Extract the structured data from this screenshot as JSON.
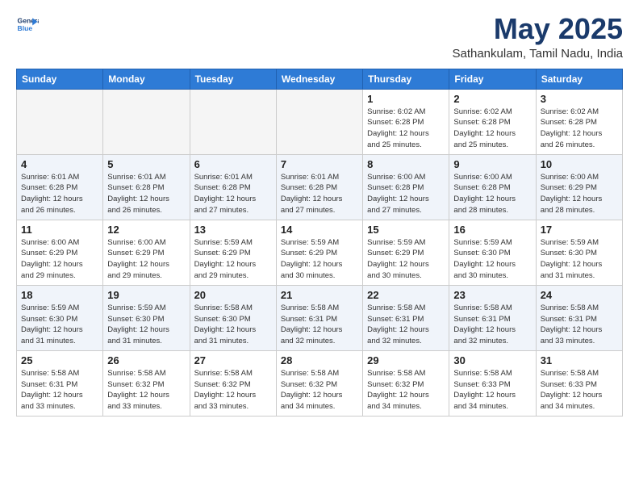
{
  "header": {
    "logo_line1": "General",
    "logo_line2": "Blue",
    "month": "May 2025",
    "location": "Sathankulam, Tamil Nadu, India"
  },
  "weekdays": [
    "Sunday",
    "Monday",
    "Tuesday",
    "Wednesday",
    "Thursday",
    "Friday",
    "Saturday"
  ],
  "weeks": [
    [
      {
        "day": "",
        "info": ""
      },
      {
        "day": "",
        "info": ""
      },
      {
        "day": "",
        "info": ""
      },
      {
        "day": "",
        "info": ""
      },
      {
        "day": "1",
        "info": "Sunrise: 6:02 AM\nSunset: 6:28 PM\nDaylight: 12 hours\nand 25 minutes."
      },
      {
        "day": "2",
        "info": "Sunrise: 6:02 AM\nSunset: 6:28 PM\nDaylight: 12 hours\nand 25 minutes."
      },
      {
        "day": "3",
        "info": "Sunrise: 6:02 AM\nSunset: 6:28 PM\nDaylight: 12 hours\nand 26 minutes."
      }
    ],
    [
      {
        "day": "4",
        "info": "Sunrise: 6:01 AM\nSunset: 6:28 PM\nDaylight: 12 hours\nand 26 minutes."
      },
      {
        "day": "5",
        "info": "Sunrise: 6:01 AM\nSunset: 6:28 PM\nDaylight: 12 hours\nand 26 minutes."
      },
      {
        "day": "6",
        "info": "Sunrise: 6:01 AM\nSunset: 6:28 PM\nDaylight: 12 hours\nand 27 minutes."
      },
      {
        "day": "7",
        "info": "Sunrise: 6:01 AM\nSunset: 6:28 PM\nDaylight: 12 hours\nand 27 minutes."
      },
      {
        "day": "8",
        "info": "Sunrise: 6:00 AM\nSunset: 6:28 PM\nDaylight: 12 hours\nand 27 minutes."
      },
      {
        "day": "9",
        "info": "Sunrise: 6:00 AM\nSunset: 6:28 PM\nDaylight: 12 hours\nand 28 minutes."
      },
      {
        "day": "10",
        "info": "Sunrise: 6:00 AM\nSunset: 6:29 PM\nDaylight: 12 hours\nand 28 minutes."
      }
    ],
    [
      {
        "day": "11",
        "info": "Sunrise: 6:00 AM\nSunset: 6:29 PM\nDaylight: 12 hours\nand 29 minutes."
      },
      {
        "day": "12",
        "info": "Sunrise: 6:00 AM\nSunset: 6:29 PM\nDaylight: 12 hours\nand 29 minutes."
      },
      {
        "day": "13",
        "info": "Sunrise: 5:59 AM\nSunset: 6:29 PM\nDaylight: 12 hours\nand 29 minutes."
      },
      {
        "day": "14",
        "info": "Sunrise: 5:59 AM\nSunset: 6:29 PM\nDaylight: 12 hours\nand 30 minutes."
      },
      {
        "day": "15",
        "info": "Sunrise: 5:59 AM\nSunset: 6:29 PM\nDaylight: 12 hours\nand 30 minutes."
      },
      {
        "day": "16",
        "info": "Sunrise: 5:59 AM\nSunset: 6:30 PM\nDaylight: 12 hours\nand 30 minutes."
      },
      {
        "day": "17",
        "info": "Sunrise: 5:59 AM\nSunset: 6:30 PM\nDaylight: 12 hours\nand 31 minutes."
      }
    ],
    [
      {
        "day": "18",
        "info": "Sunrise: 5:59 AM\nSunset: 6:30 PM\nDaylight: 12 hours\nand 31 minutes."
      },
      {
        "day": "19",
        "info": "Sunrise: 5:59 AM\nSunset: 6:30 PM\nDaylight: 12 hours\nand 31 minutes."
      },
      {
        "day": "20",
        "info": "Sunrise: 5:58 AM\nSunset: 6:30 PM\nDaylight: 12 hours\nand 31 minutes."
      },
      {
        "day": "21",
        "info": "Sunrise: 5:58 AM\nSunset: 6:31 PM\nDaylight: 12 hours\nand 32 minutes."
      },
      {
        "day": "22",
        "info": "Sunrise: 5:58 AM\nSunset: 6:31 PM\nDaylight: 12 hours\nand 32 minutes."
      },
      {
        "day": "23",
        "info": "Sunrise: 5:58 AM\nSunset: 6:31 PM\nDaylight: 12 hours\nand 32 minutes."
      },
      {
        "day": "24",
        "info": "Sunrise: 5:58 AM\nSunset: 6:31 PM\nDaylight: 12 hours\nand 33 minutes."
      }
    ],
    [
      {
        "day": "25",
        "info": "Sunrise: 5:58 AM\nSunset: 6:31 PM\nDaylight: 12 hours\nand 33 minutes."
      },
      {
        "day": "26",
        "info": "Sunrise: 5:58 AM\nSunset: 6:32 PM\nDaylight: 12 hours\nand 33 minutes."
      },
      {
        "day": "27",
        "info": "Sunrise: 5:58 AM\nSunset: 6:32 PM\nDaylight: 12 hours\nand 33 minutes."
      },
      {
        "day": "28",
        "info": "Sunrise: 5:58 AM\nSunset: 6:32 PM\nDaylight: 12 hours\nand 34 minutes."
      },
      {
        "day": "29",
        "info": "Sunrise: 5:58 AM\nSunset: 6:32 PM\nDaylight: 12 hours\nand 34 minutes."
      },
      {
        "day": "30",
        "info": "Sunrise: 5:58 AM\nSunset: 6:33 PM\nDaylight: 12 hours\nand 34 minutes."
      },
      {
        "day": "31",
        "info": "Sunrise: 5:58 AM\nSunset: 6:33 PM\nDaylight: 12 hours\nand 34 minutes."
      }
    ]
  ]
}
